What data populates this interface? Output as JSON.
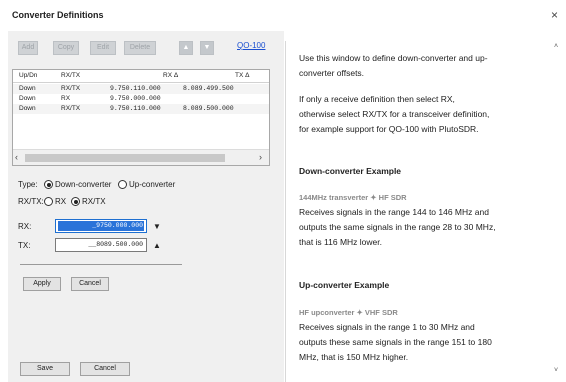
{
  "window": {
    "title": "Converter Definitions",
    "close_glyph": "×"
  },
  "toolbar": {
    "add": "Add",
    "copy": "Copy",
    "edit": "Edit",
    "delete": "Delete",
    "up_glyph": "▲",
    "down_glyph": "▼",
    "link": "QO-100"
  },
  "table": {
    "headers": [
      "Up/Dn",
      "RX/TX",
      "RX Δ",
      "TX Δ"
    ],
    "rows": [
      [
        "Down",
        "RX/TX",
        "9.750.110.000",
        "8.089.499.500"
      ],
      [
        "Down",
        "RX",
        "9.750.000.000",
        ""
      ],
      [
        "Down",
        "RX/TX",
        "9.750.110.000",
        "8.089.500.000"
      ]
    ]
  },
  "scroll": {
    "left_glyph": "‹",
    "right_glyph": "›"
  },
  "form": {
    "type_label": "Type:",
    "type_options": [
      "Down-converter",
      "Up-converter"
    ],
    "type_selected": "Down-converter",
    "rxtx_label": "RX/TX:",
    "rxtx_options": [
      "RX",
      "RX/TX"
    ],
    "rxtx_selected": "RX/TX",
    "rx_label": "RX:",
    "rx_value": "_9750.000.000",
    "rx_spin_glyph": "▼",
    "tx_label": "TX:",
    "tx_value": "__8089.500.000",
    "tx_spin_glyph": "▲"
  },
  "actions": {
    "apply": "Apply",
    "cancel": "Cancel",
    "save": "Save",
    "bottom_cancel": "Cancel"
  },
  "help": {
    "intro1_lines": [
      "Use this window to define down-converter and up-",
      "converter offsets."
    ],
    "intro2_lines": [
      "If only a receive definition then select RX,",
      "otherwise select RX/TX for a transceiver definition,",
      "for example support for QO-100 with PlutoSDR."
    ],
    "down_heading": "Down-converter Example",
    "down_sub": "144MHz transverter ✦ HF SDR",
    "down_lines": [
      "Receives signals in the range 144 to 146 MHz and",
      "outputs the same signals in the range 28 to 30 MHz,",
      "that is 116 MHz lower."
    ],
    "up_heading": "Up-converter Example",
    "up_sub": "HF upconverter ✦ VHF SDR",
    "up_lines": [
      "Receives signals in the range 1 to 30 MHz and",
      "outputs these same signals in the range 151 to 180",
      "MHz, that is 150 MHz higher."
    ],
    "scroll_up_glyph": "˄",
    "scroll_down_glyph": "˅"
  }
}
